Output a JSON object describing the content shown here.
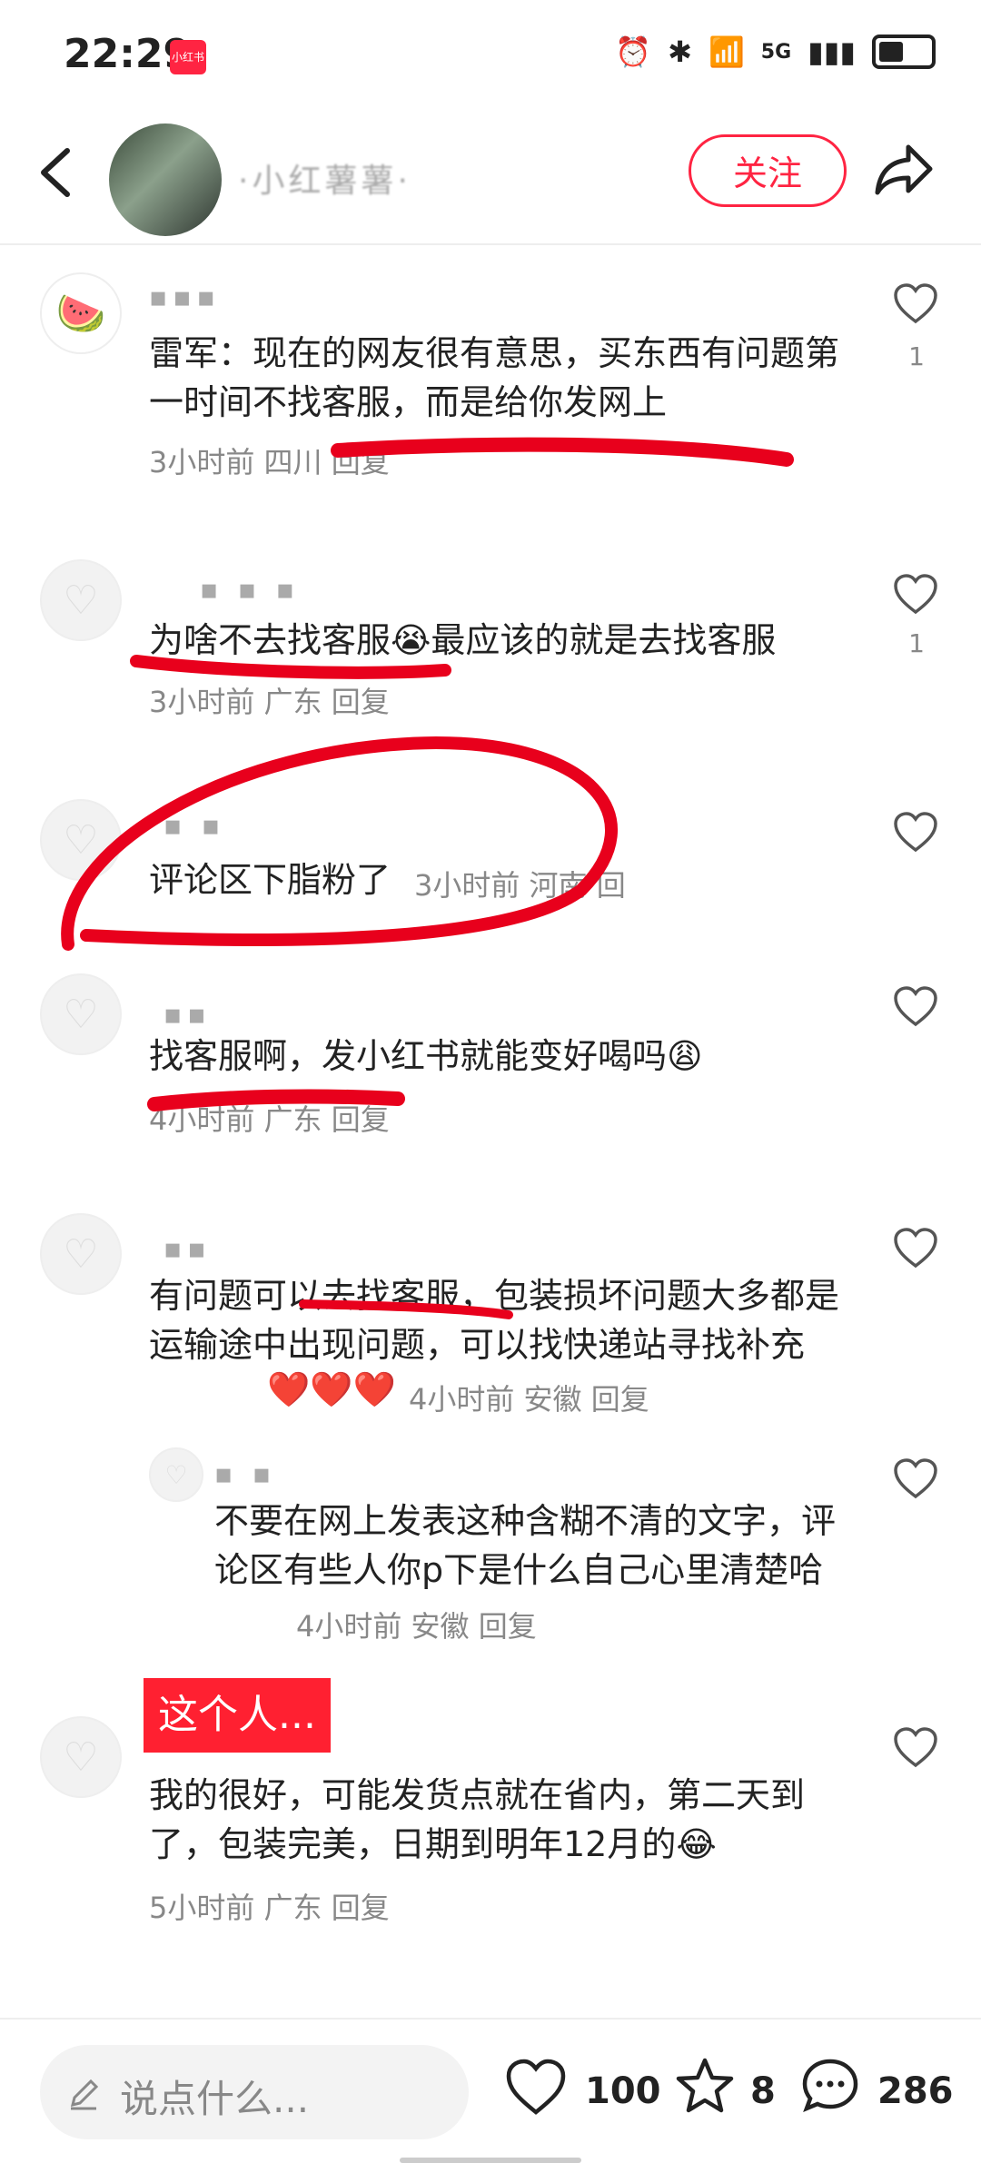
{
  "status_bar": {
    "time": "22:29",
    "app_badge": "小红书",
    "network": "5G"
  },
  "header": {
    "author_name": "·小红薯薯·",
    "follow_label": "关注"
  },
  "comments": [
    {
      "text": "雷军：现在的网友很有意思，买东西有问题第一时间不找客服，而是给你发网上",
      "meta": "3小时前 四川 回复",
      "likes": "1"
    },
    {
      "text": "为啥不去找客服",
      "emoji": "😭",
      "text2": "最应该的就是去找客服",
      "meta": "3小时前 广东 回复",
      "likes": "1"
    },
    {
      "text": "评论区下脂粉了",
      "meta": "3小时前 河南 回",
      "likes": ""
    },
    {
      "text": "找客服啊，发小红书就能变好喝吗",
      "emoji": "😩",
      "meta": "4小时前 广东 回复",
      "likes": ""
    },
    {
      "text": "有问题可以去找客服，包装损坏问题大多都是运输途中出现问题，可以找快递站寻找补充",
      "hearts": "❤️❤️❤️",
      "meta": "4小时前 安徽 回复",
      "likes": ""
    },
    {
      "text": "不要在网上发表这种含糊不清的文字，评论区有些人你p下是什么自己心里清楚哈",
      "meta": "4小时前 安徽 回复",
      "likes": ""
    },
    {
      "text": "我的很好，可能发货点就在省内，第二天到了，包装完美，日期到明年12月的",
      "emoji": "😂",
      "meta": "5小时前 广东 回复",
      "likes": ""
    }
  ],
  "overlay_label": "这个人...",
  "bottom_bar": {
    "placeholder": "说点什么...",
    "likes": "100",
    "stars": "8",
    "comments": "286"
  }
}
